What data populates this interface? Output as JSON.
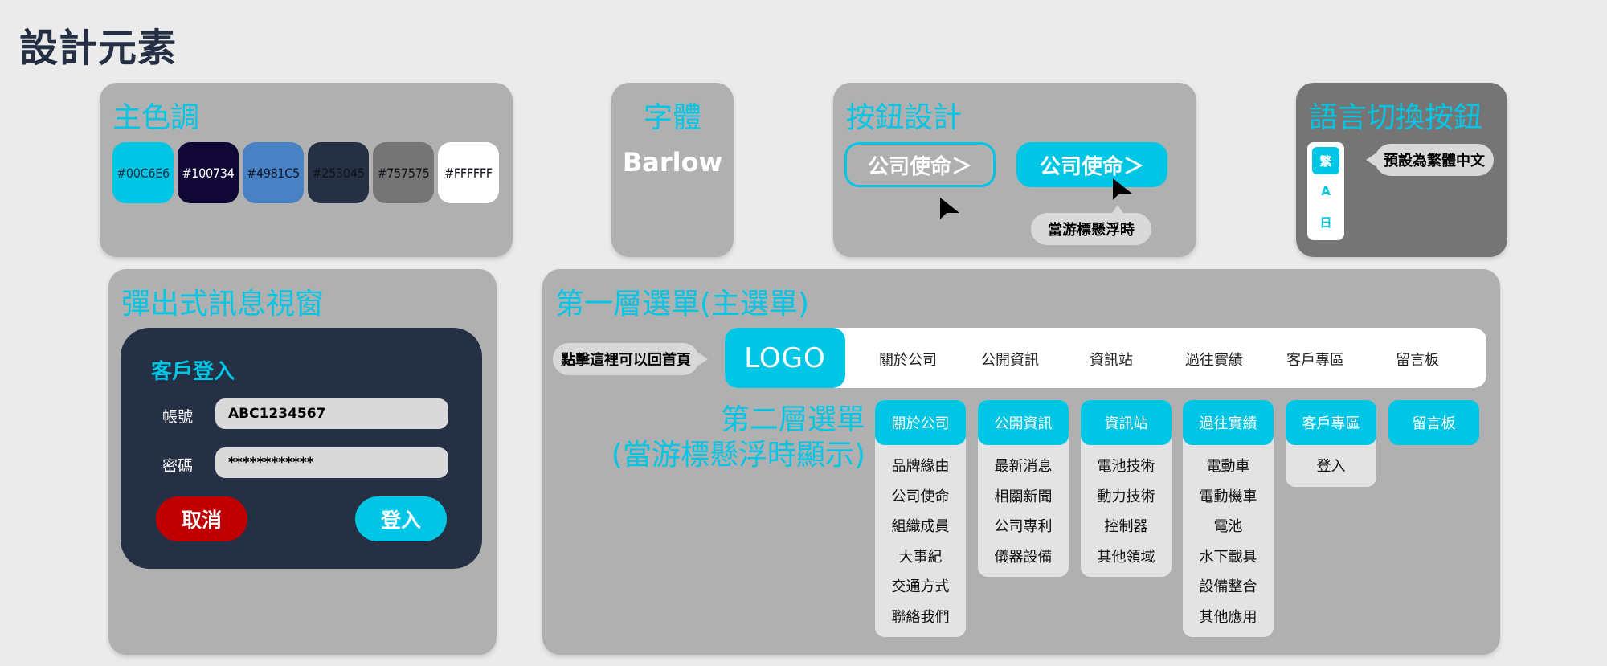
{
  "page_title": "設計元素",
  "colors": {
    "title": "主色調",
    "swatches": [
      {
        "hex": "#00C6E6",
        "label": "#00C6E6",
        "text_color": "#253045"
      },
      {
        "hex": "#100734",
        "label": "#100734",
        "text_color": "#ffffff"
      },
      {
        "hex": "#4981C5",
        "label": "#4981C5",
        "text_color": "#10192b"
      },
      {
        "hex": "#253045",
        "label": "#253045",
        "text_color": "#10131a"
      },
      {
        "hex": "#757575",
        "label": "#757575",
        "text_color": "#10131a"
      },
      {
        "hex": "#FFFFFF",
        "label": "#FFFFFF",
        "text_color": "#10131a"
      }
    ]
  },
  "font": {
    "title": "字體",
    "name": "Barlow"
  },
  "buttons": {
    "title": "按鈕設計",
    "outline_label": "公司使命＞",
    "filled_label": "公司使命＞",
    "hover_note": "當游標懸浮時"
  },
  "language": {
    "title": "語言切換按鈕",
    "options": [
      "繁",
      "A",
      "日"
    ],
    "note": "預設為繁體中文"
  },
  "popup": {
    "title": "彈出式訊息視窗",
    "card_title": "客戶登入",
    "account_label": "帳號",
    "account_value": "ABC1234567",
    "password_label": "密碼",
    "password_value": "************",
    "cancel_label": "取消",
    "login_label": "登入"
  },
  "menu": {
    "title": "第一層選單(主選單)",
    "home_note": "點擊這裡可以回首頁",
    "logo": "LOGO",
    "nav_items": [
      "關於公司",
      "公開資訊",
      "資訊站",
      "過往實績",
      "客戶專區",
      "留言板"
    ],
    "second_title_line1": "第二層選單",
    "second_title_line2": "(當游標懸浮時顯示)",
    "submenus": [
      {
        "head": "關於公司",
        "items": [
          "品牌緣由",
          "公司使命",
          "組織成員",
          "大事紀",
          "交通方式",
          "聯絡我們"
        ]
      },
      {
        "head": "公開資訊",
        "items": [
          "最新消息",
          "相關新聞",
          "公司專利",
          "儀器設備"
        ]
      },
      {
        "head": "資訊站",
        "items": [
          "電池技術",
          "動力技術",
          "控制器",
          "其他領域"
        ]
      },
      {
        "head": "過往實績",
        "items": [
          "電動車",
          "電動機車",
          "電池",
          "水下載具",
          "設備整合",
          "其他應用"
        ]
      },
      {
        "head": "客戶專區",
        "items": [
          "登入"
        ]
      },
      {
        "head": "留言板",
        "items": []
      }
    ]
  }
}
